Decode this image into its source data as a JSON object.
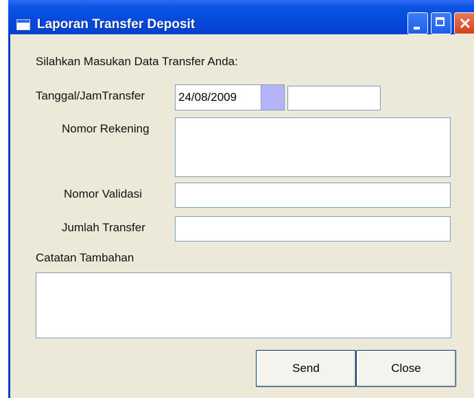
{
  "window": {
    "title": "Laporan Transfer Deposit"
  },
  "form": {
    "intro": "Silahkan Masukan Data Transfer Anda:",
    "tanggal_label": "Tanggal/JamTransfer",
    "tanggal_value": "24/08/2009",
    "jam_value": "",
    "rekening_label": "Nomor Rekening",
    "rekening_value": "",
    "validasi_label": "Nomor Validasi",
    "validasi_value": "",
    "jumlah_label": "Jumlah Transfer",
    "jumlah_value": "",
    "catatan_label": "Catatan Tambahan",
    "catatan_value": ""
  },
  "buttons": {
    "send": "Send",
    "close": "Close"
  },
  "icons": [
    "window-icon",
    "minimize-icon",
    "maximize-icon",
    "close-icon",
    "dropdown-icon"
  ]
}
